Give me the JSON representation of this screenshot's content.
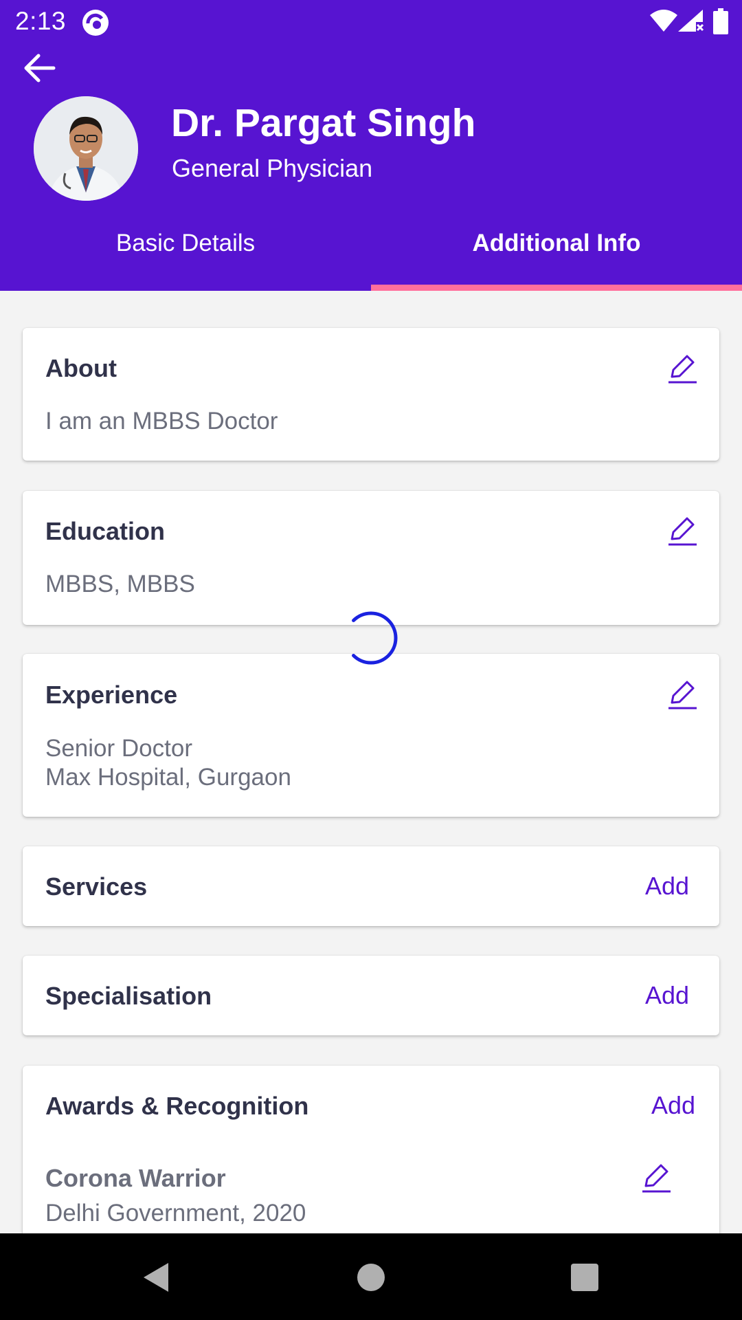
{
  "status_bar": {
    "time": "2:13"
  },
  "profile": {
    "name": "Dr. Pargat Singh",
    "role": "General Physician"
  },
  "tabs": [
    {
      "label": "Basic Details",
      "selected": false
    },
    {
      "label": "Additional Info",
      "selected": true
    }
  ],
  "cards": {
    "about": {
      "title": "About",
      "text": "I am an MBBS Doctor"
    },
    "education": {
      "title": "Education",
      "text": "MBBS, MBBS"
    },
    "experience": {
      "title": "Experience",
      "line1": "Senior Doctor",
      "line2": "Max Hospital, Gurgaon"
    },
    "services": {
      "title": "Services",
      "action": "Add"
    },
    "specialisation": {
      "title": "Specialisation",
      "action": "Add"
    },
    "awards": {
      "title": "Awards & Recognition",
      "action": "Add",
      "items": [
        {
          "name": "Corona Warrior",
          "detail": "Delhi Government, 2020"
        }
      ]
    }
  },
  "icons": {
    "back": "arrow-left-icon",
    "edit": "pencil-icon",
    "loading": "spinner-icon",
    "nav": [
      "nav-back-icon",
      "nav-home-icon",
      "nav-recent-icon"
    ]
  },
  "colors": {
    "primary": "#5714d1",
    "tab_indicator": "#ff6f9c",
    "title_text": "#30324a",
    "body_text": "#6b6e7c",
    "spinner": "#1a22e0"
  }
}
